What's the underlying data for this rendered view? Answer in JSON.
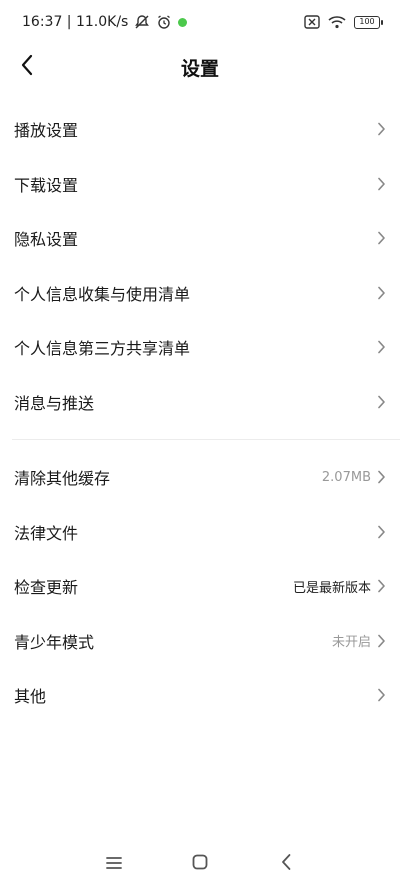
{
  "status_bar": {
    "time_speed": "16:37 | 11.0K/s",
    "battery": "100"
  },
  "header": {
    "title": "设置"
  },
  "sections": [
    {
      "items": [
        {
          "label": "播放设置"
        },
        {
          "label": "下载设置"
        },
        {
          "label": "隐私设置"
        },
        {
          "label": "个人信息收集与使用清单"
        },
        {
          "label": "个人信息第三方共享清单"
        },
        {
          "label": "消息与推送"
        }
      ]
    },
    {
      "items": [
        {
          "label": "清除其他缓存",
          "value": "2.07MB"
        },
        {
          "label": "法律文件"
        },
        {
          "label": "检查更新",
          "value": "已是最新版本"
        },
        {
          "label": "青少年模式",
          "value": "未开启"
        },
        {
          "label": "其他"
        }
      ]
    }
  ],
  "icons": {
    "back": "back-arrow-icon",
    "chevron": "chevron-right-icon",
    "nav_menu": "menu-icon",
    "nav_home": "home-square-icon",
    "nav_back": "back-triangle-icon"
  }
}
